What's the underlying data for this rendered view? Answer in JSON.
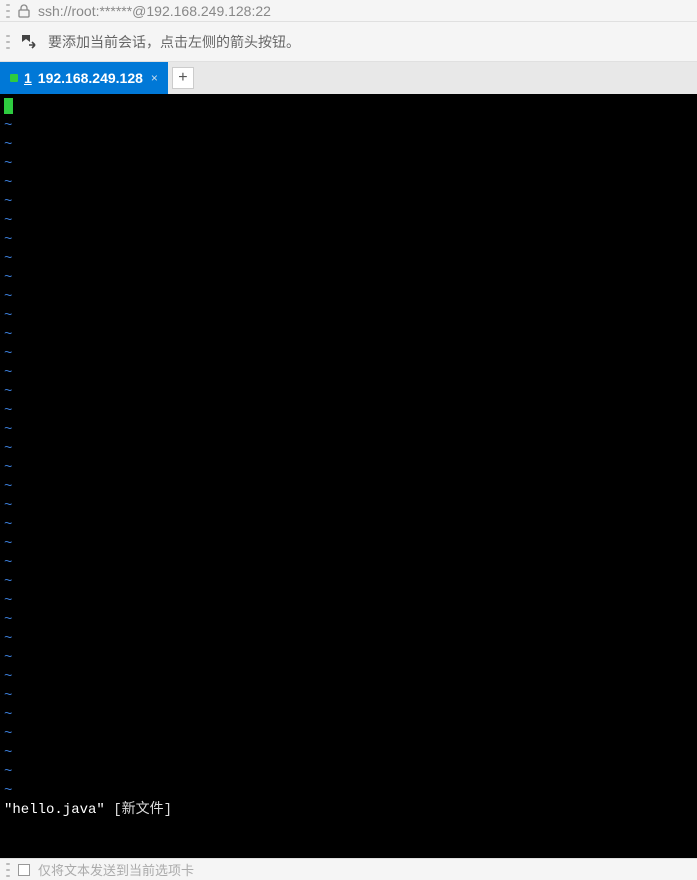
{
  "toolbar": {
    "url": "ssh://root:******@192.168.249.128:22"
  },
  "hint": {
    "text": "要添加当前会话，点击左侧的箭头按钮。"
  },
  "tab": {
    "number": "1",
    "label": "192.168.249.128",
    "new_tab": "+"
  },
  "terminal": {
    "tilde": "~",
    "tilde_count": 36,
    "status_filename": "\"hello.java\"",
    "status_suffix": " [新文件]"
  },
  "bottom": {
    "text": "仅将文本发送到当前选项卡"
  }
}
